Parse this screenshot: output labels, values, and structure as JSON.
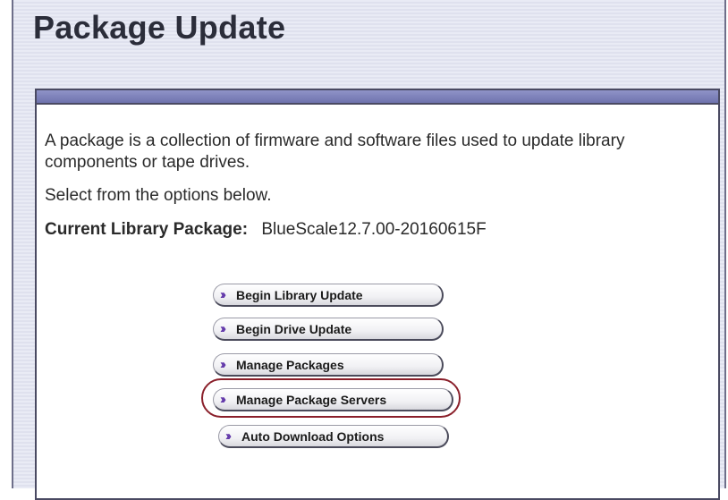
{
  "page": {
    "title": "Package Update"
  },
  "panel": {
    "description": "A package is a collection of firmware and software files used to update library components or tape drives.",
    "select_text": "Select from the options below.",
    "current_label": "Current Library Package:",
    "current_value": "BlueScale12.7.00-20160615F"
  },
  "buttons": [
    {
      "label": "Begin Library Update",
      "icon": "double-chevron-right-icon"
    },
    {
      "label": "Begin Drive Update",
      "icon": "double-chevron-right-icon"
    },
    {
      "label": "Manage Packages",
      "icon": "double-chevron-right-icon"
    },
    {
      "label": "Manage Package Servers",
      "icon": "double-chevron-right-icon",
      "highlighted": true
    },
    {
      "label": "Auto Download Options",
      "icon": "double-chevron-right-icon"
    }
  ],
  "colors": {
    "icon": "#5b2fa6",
    "panel_header": "#7f83bd",
    "highlight_ring": "#8a1f2a",
    "background": "#e4e6f2"
  }
}
